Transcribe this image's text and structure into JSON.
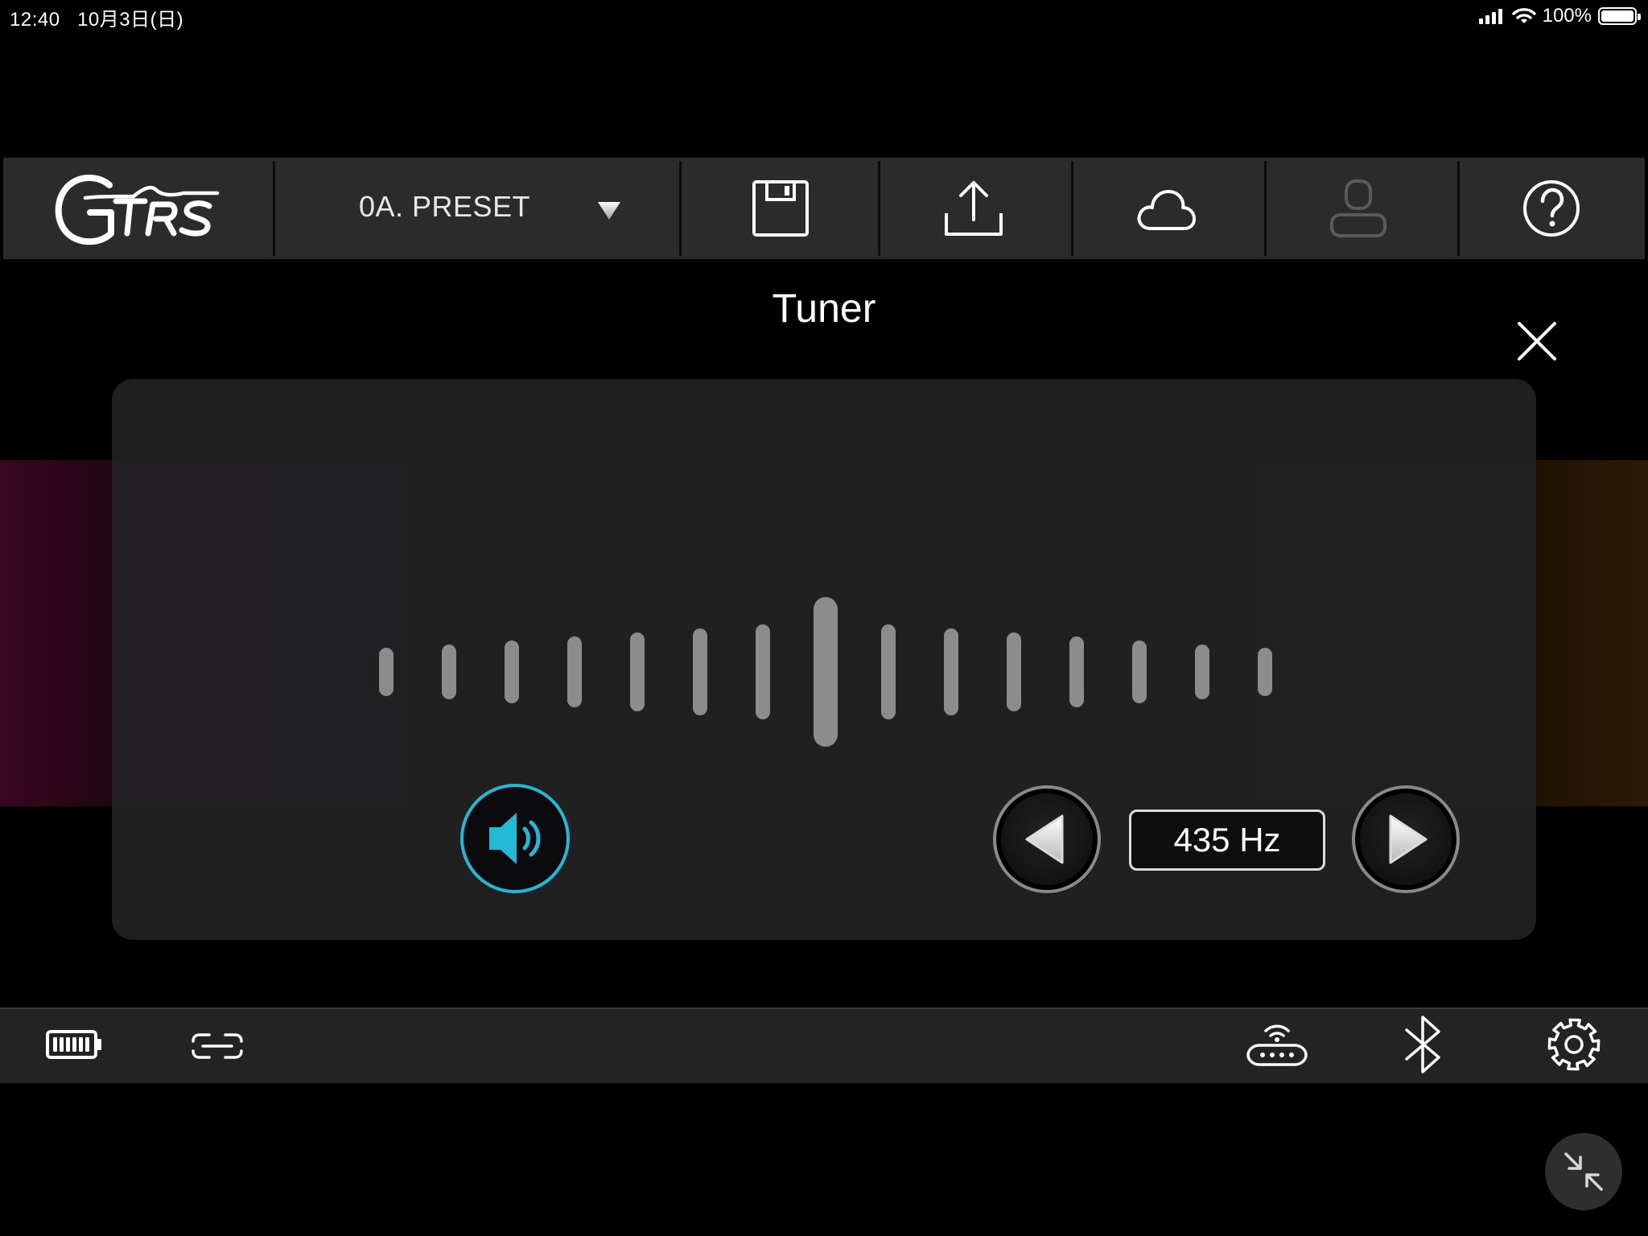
{
  "status_bar": {
    "time": "12:40",
    "date": "10月3日(日)",
    "battery_pct": "100%",
    "battery_level": 1.0
  },
  "toolbar": {
    "logo_text": "GTRS",
    "preset_label": "0A. PRESET",
    "icons": [
      "save-icon",
      "upload-icon",
      "cloud-icon",
      "user-icon",
      "help-icon"
    ]
  },
  "tuner": {
    "title": "Tuner",
    "frequency_label": "435 Hz",
    "sound_enabled": true,
    "indicator_count": 15,
    "active_indicator": 7
  },
  "bottom_bar": {
    "icons": [
      "battery-icon",
      "link-icon",
      "router-icon",
      "bluetooth-icon",
      "gear-icon"
    ]
  },
  "colors": {
    "background": "#000000",
    "toolbar": "#2b2b2b",
    "panel": "#222223",
    "accent": "#22b8d6",
    "indicator": "#8c8c8c"
  }
}
